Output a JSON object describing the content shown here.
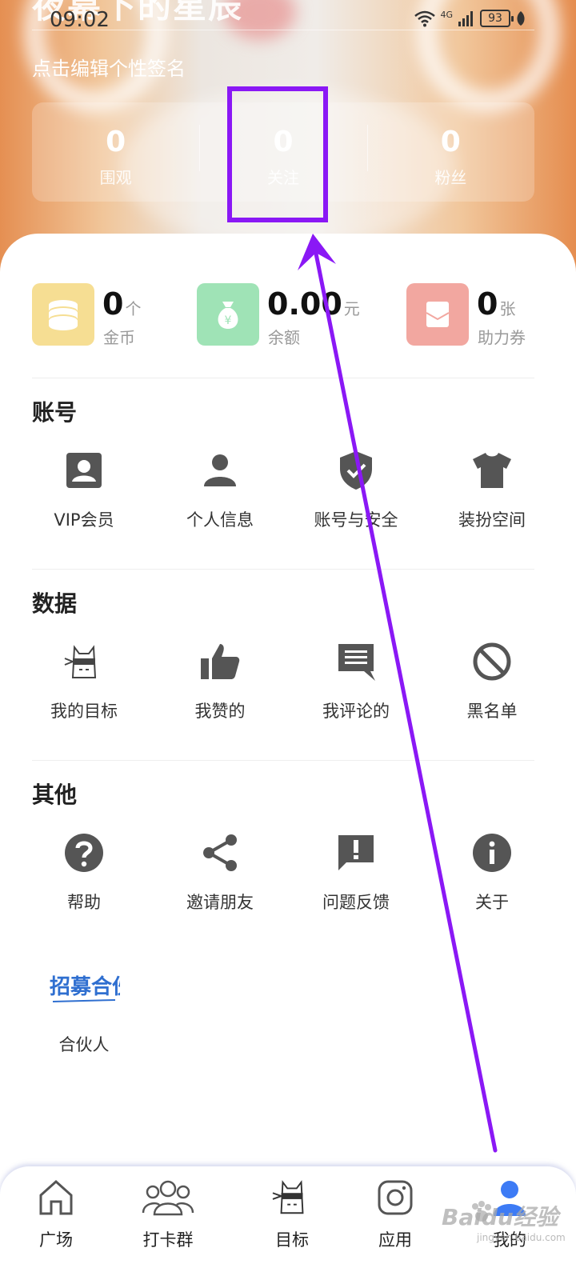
{
  "status_bar": {
    "time": "09:02",
    "network": "4G",
    "battery": "93"
  },
  "profile": {
    "name": "夜幕下的星辰",
    "signature": "点击编辑个性签名",
    "stats": [
      {
        "value": "0",
        "label": "围观"
      },
      {
        "value": "0",
        "label": "关注"
      },
      {
        "value": "0",
        "label": "粉丝"
      }
    ]
  },
  "wallet": [
    {
      "value": "0",
      "unit": "个",
      "label": "金币",
      "icon": "coins-icon",
      "color": "#f6de93"
    },
    {
      "value": "0.00",
      "unit": "元",
      "label": "余额",
      "icon": "money-bag-icon",
      "color": "#9fe3b6"
    },
    {
      "value": "0",
      "unit": "张",
      "label": "助力券",
      "icon": "coupon-icon",
      "color": "#f2a7a0"
    }
  ],
  "sections": {
    "account": {
      "title": "账号",
      "items": [
        {
          "label": "VIP会员",
          "icon": "vip-card-icon"
        },
        {
          "label": "个人信息",
          "icon": "person-icon"
        },
        {
          "label": "账号与安全",
          "icon": "shield-check-icon"
        },
        {
          "label": "装扮空间",
          "icon": "shirt-icon"
        }
      ]
    },
    "data": {
      "title": "数据",
      "items": [
        {
          "label": "我的目标",
          "icon": "ninja-cat-icon"
        },
        {
          "label": "我赞的",
          "icon": "thumbs-up-icon"
        },
        {
          "label": "我评论的",
          "icon": "comment-icon"
        },
        {
          "label": "黑名单",
          "icon": "block-icon"
        }
      ]
    },
    "other": {
      "title": "其他",
      "items": [
        {
          "label": "帮助",
          "icon": "help-icon"
        },
        {
          "label": "邀请朋友",
          "icon": "share-icon"
        },
        {
          "label": "问题反馈",
          "icon": "feedback-icon"
        },
        {
          "label": "关于",
          "icon": "info-icon"
        }
      ],
      "partner": {
        "label": "合伙人",
        "logo_text": "招募合伙人"
      }
    }
  },
  "tabbar": [
    {
      "label": "广场",
      "icon": "home-icon"
    },
    {
      "label": "打卡群",
      "icon": "group-icon"
    },
    {
      "label": "目标",
      "icon": "ninja-cat-icon"
    },
    {
      "label": "应用",
      "icon": "camera-icon"
    },
    {
      "label": "我的",
      "icon": "user-icon",
      "active": true
    }
  ],
  "watermark": {
    "brand": "Baidu经验",
    "url": "jingyan.baidu.com"
  },
  "colors": {
    "annotation": "#8a18f5",
    "active_tab": "#3d7bf5",
    "icon_gray": "#555555"
  }
}
